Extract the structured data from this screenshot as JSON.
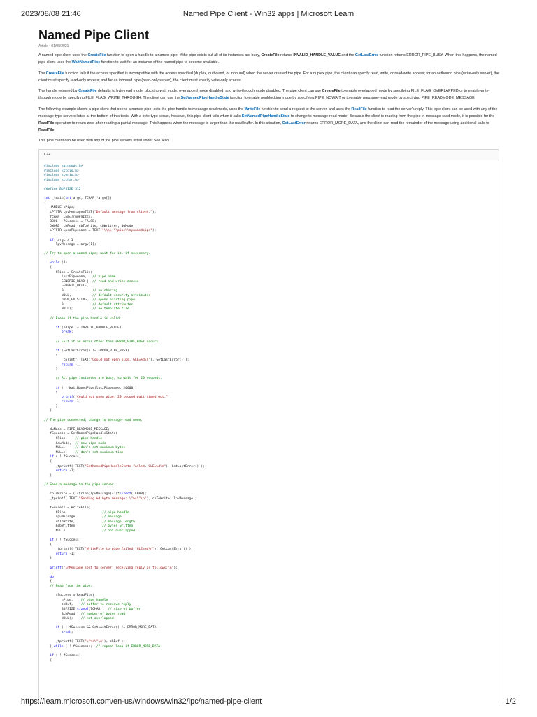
{
  "print_header": {
    "datetime": "2023/08/08 21:46",
    "title": "Named Pipe Client - Win32 apps | Microsoft Learn"
  },
  "print_footer": {
    "url": "https://learn.microsoft.com/en-us/windows/win32/ipc/named-pipe-client",
    "page": "1/2"
  },
  "article": {
    "title": "Named Pipe Client",
    "meta": "Article • 01/08/2021",
    "paragraphs": [
      [
        [
          "t",
          "A named pipe client uses the "
        ],
        [
          "a",
          "CreateFile"
        ],
        [
          "t",
          " function to open a handle to a named pipe. If the pipe exists but all of its instances are busy, "
        ],
        [
          "b",
          "CreateFile"
        ],
        [
          "t",
          " returns "
        ],
        [
          "b",
          "INVALID_HANDLE_VALUE"
        ],
        [
          "t",
          " and the "
        ],
        [
          "a",
          "GetLastError"
        ],
        [
          "t",
          " function returns ERROR_PIPE_BUSY. When this happens, the named pipe client uses the "
        ],
        [
          "a",
          "WaitNamedPipe"
        ],
        [
          "t",
          " function to wait for an instance of the named pipe to become available."
        ]
      ],
      [
        [
          "t",
          "The "
        ],
        [
          "a",
          "CreateFile"
        ],
        [
          "t",
          " function fails if the access specified is incompatible with the access specified (duplex, outbound, or inbound) when the server created the pipe. For a duplex pipe, the client can specify read, write, or read/write access; for an outbound pipe (write-only server), the client must specify read-only access; and for an inbound pipe (read-only server), the client must specify write-only access."
        ]
      ],
      [
        [
          "t",
          "The handle returned by "
        ],
        [
          "a",
          "CreateFile"
        ],
        [
          "t",
          " defaults to byte-read mode, blocking-wait mode, overlapped mode disabled, and write-through mode disabled. The pipe client can use "
        ],
        [
          "b",
          "CreateFile"
        ],
        [
          "t",
          " to enable overlapped mode by specifying FILE_FLAG_OVERLAPPED or to enable write-through mode by specifying FILE_FLAG_WRITE_THROUGH. The client can use the "
        ],
        [
          "a",
          "SetNamedPipeHandleState"
        ],
        [
          "t",
          " function to enable nonblocking mode by specifying PIPE_NOWAIT or to enable message-read mode by specifying PIPE_READMODE_MESSAGE."
        ]
      ],
      [
        [
          "t",
          "The following example shows a pipe client that opens a named pipe, sets the pipe handle to message-read mode, uses the "
        ],
        [
          "a",
          "WriteFile"
        ],
        [
          "t",
          " function to send a request to the server, and uses the "
        ],
        [
          "a",
          "ReadFile"
        ],
        [
          "t",
          " function to read the server's reply. This pipe client can be used with any of the message-type servers listed at the bottom of this topic. With a byte-type server, however, this pipe client fails when it calls "
        ],
        [
          "a",
          "SetNamedPipeHandleState"
        ],
        [
          "t",
          " to change to message-read mode. Because the client is reading from the pipe in message-read mode, it is possible for the "
        ],
        [
          "b",
          "ReadFile"
        ],
        [
          "t",
          " operation to return zero after reading a partial message. This happens when the message is larger than the read buffer. In this situation, "
        ],
        [
          "a",
          "GetLastError"
        ],
        [
          "t",
          " returns ERROR_MORE_DATA, and the client can read the remainder of the message using additional calls to "
        ],
        [
          "b",
          "ReadFile"
        ],
        [
          "t",
          "."
        ]
      ],
      [
        [
          "t",
          "This pipe client can be used with any of the pipe servers listed under See Also."
        ]
      ]
    ],
    "code": {
      "language": "C++",
      "lines": [
        "#include <windows.h>",
        "#include <stdio.h>",
        "#include <conio.h>",
        "#include <tchar.h>",
        "",
        "#define BUFSIZE 512",
        "",
        "int _tmain(int argc, TCHAR *argv[])",
        "{",
        "   HANDLE hPipe;",
        "   LPTSTR lpvMessage=TEXT(\"Default message from client.\");",
        "   TCHAR  chBuf[BUFSIZE];",
        "   BOOL   fSuccess = FALSE;",
        "   DWORD  cbRead, cbToWrite, cbWritten, dwMode;",
        "   LPTSTR lpszPipename = TEXT(\"\\\\\\\\.\\\\pipe\\\\mynamedpipe\");",
        "",
        "   if( argc > 1 )",
        "      lpvMessage = argv[1];",
        "",
        "// Try to open a named pipe; wait for it, if necessary.",
        "",
        "   while (1)",
        "   {",
        "      hPipe = CreateFile(",
        "         lpszPipename,   // pipe name",
        "         GENERIC_READ |  // read and write access",
        "         GENERIC_WRITE,",
        "         0,              // no sharing",
        "         NULL,           // default security attributes",
        "         OPEN_EXISTING,  // opens existing pipe",
        "         0,              // default attributes",
        "         NULL);          // no template file",
        "",
        "   // Break if the pipe handle is valid.",
        "",
        "      if (hPipe != INVALID_HANDLE_VALUE)",
        "         break;",
        "",
        "      // Exit if an error other than ERROR_PIPE_BUSY occurs.",
        "",
        "      if (GetLastError() != ERROR_PIPE_BUSY)",
        "      {",
        "         _tprintf( TEXT(\"Could not open pipe. GLE=%d\\n\"), GetLastError() );",
        "         return -1;",
        "      }",
        "",
        "      // All pipe instances are busy, so wait for 20 seconds.",
        "",
        "      if ( ! WaitNamedPipe(lpszPipename, 20000))",
        "      {",
        "         printf(\"Could not open pipe: 20 second wait timed out.\");",
        "         return -1;",
        "      }",
        "   }",
        "",
        "// The pipe connected; change to message-read mode.",
        "",
        "   dwMode = PIPE_READMODE_MESSAGE;",
        "   fSuccess = SetNamedPipeHandleState(",
        "      hPipe,    // pipe handle",
        "      &dwMode,  // new pipe mode",
        "      NULL,     // don't set maximum bytes",
        "      NULL);    // don't set maximum time",
        "   if ( ! fSuccess)",
        "   {",
        "      _tprintf( TEXT(\"SetNamedPipeHandleState failed. GLE=%d\\n\"), GetLastError() );",
        "      return -1;",
        "   }",
        "",
        "// Send a message to the pipe server.",
        "",
        "   cbToWrite = (lstrlen(lpvMessage)+1)*sizeof(TCHAR);",
        "   _tprintf( TEXT(\"Sending %d byte message: \\\"%s\\\"\\n\"), cbToWrite, lpvMessage);",
        "",
        "   fSuccess = WriteFile(",
        "      hPipe,                  // pipe handle",
        "      lpvMessage,             // message",
        "      cbToWrite,              // message length",
        "      &cbWritten,             // bytes written",
        "      NULL);                  // not overlapped",
        "",
        "   if ( ! fSuccess)",
        "   {",
        "      _tprintf( TEXT(\"WriteFile to pipe failed. GLE=%d\\n\"), GetLastError() );",
        "      return -1;",
        "   }",
        "",
        "   printf(\"\\nMessage sent to server, receiving reply as follows:\\n\");",
        "",
        "   do",
        "   {",
        "   // Read from the pipe.",
        "",
        "      fSuccess = ReadFile(",
        "         hPipe,    // pipe handle",
        "         chBuf,    // buffer to receive reply",
        "         BUFSIZE*sizeof(TCHAR),  // size of buffer",
        "         &cbRead,  // number of bytes read",
        "         NULL);    // not overlapped",
        "",
        "      if ( ! fSuccess && GetLastError() != ERROR_MORE_DATA )",
        "         break;",
        "",
        "      _tprintf( TEXT(\"\\\"%s\\\"\\n\"), chBuf );",
        "   } while ( ! fSuccess);  // repeat loop if ERROR_MORE_DATA",
        "",
        "   if ( ! fSuccess)",
        "   {"
      ]
    }
  },
  "colors": {
    "link": "#0065b3",
    "comment": "#008000",
    "string": "#a31515",
    "keyword": "#0000ff"
  }
}
